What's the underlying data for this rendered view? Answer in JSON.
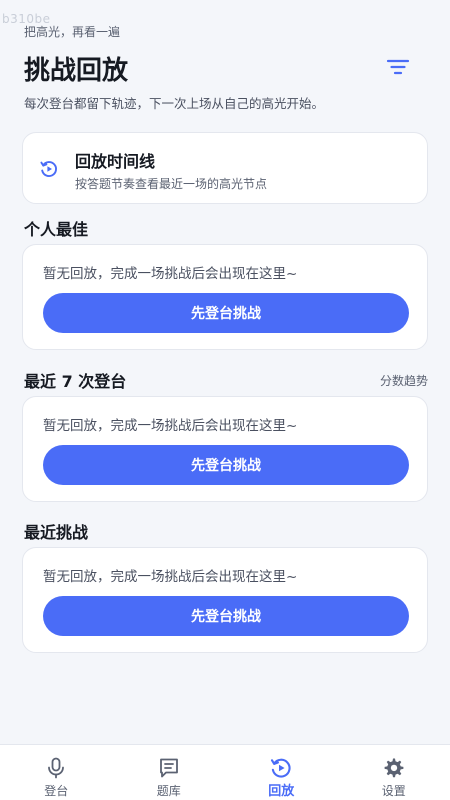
{
  "watermark": "b310be",
  "header": {
    "kicker": "把高光，再看一遍",
    "title": "挑战回放",
    "subtitle": "每次登台都留下轨迹，下一次上场从自己的高光开始。",
    "filter_icon": "filter-icon"
  },
  "timeline": {
    "icon": "replay-icon",
    "title": "回放时间线",
    "description": "按答题节奏查看最近一场的高光节点"
  },
  "sections": [
    {
      "title": "个人最佳",
      "link": "",
      "empty_text": "暂无回放，完成一场挑战后会出现在这里~",
      "cta_label": "先登台挑战"
    },
    {
      "title": "最近 7 次登台",
      "link": "分数趋势",
      "empty_text": "暂无回放，完成一场挑战后会出现在这里~",
      "cta_label": "先登台挑战"
    },
    {
      "title": "最近挑战",
      "link": "",
      "empty_text": "暂无回放，完成一场挑战后会出现在这里~",
      "cta_label": "先登台挑战"
    }
  ],
  "tabbar": {
    "items": [
      {
        "label": "登台",
        "icon": "microphone-icon",
        "active": false
      },
      {
        "label": "题库",
        "icon": "question-bank-icon",
        "active": false
      },
      {
        "label": "回放",
        "icon": "replay-icon",
        "active": true
      },
      {
        "label": "设置",
        "icon": "gear-icon",
        "active": false
      }
    ]
  },
  "colors": {
    "accent": "#4A6CF7",
    "background": "#F4F6FA",
    "card": "#FFFFFF",
    "text_primary": "#161A22",
    "text_secondary": "#5B6272"
  }
}
